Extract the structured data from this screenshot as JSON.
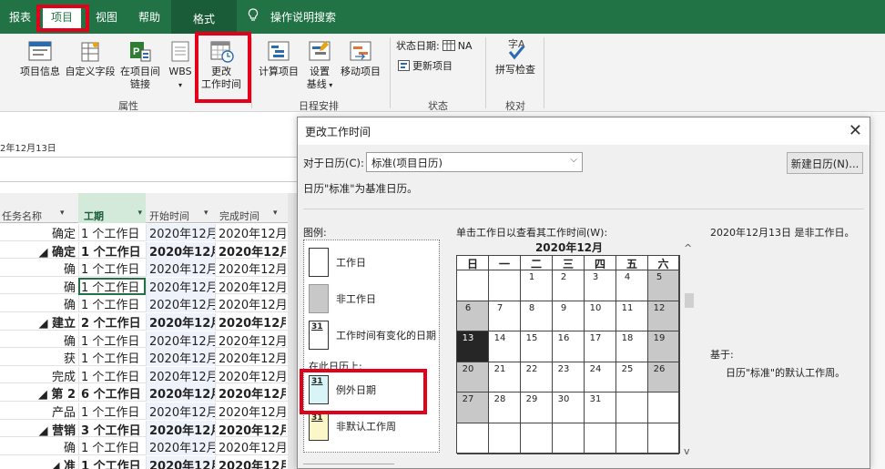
{
  "tabs": {
    "report": "报表",
    "project": "项目",
    "view": "视图",
    "help": "帮助",
    "format": "格式",
    "search": "操作说明搜索"
  },
  "ribbon": {
    "project_info": "项目信息",
    "custom_fields": "自定义字段",
    "links_line1": "在项目间",
    "links_line2": "链接",
    "wbs": "WBS",
    "change_time_line1": "更改",
    "change_time_line2": "工作时间",
    "calc_project": "计算项目",
    "set_baseline_line1": "设置",
    "set_baseline_line2": "基线",
    "move_project": "移动项目",
    "status_date_label": "状态日期:",
    "status_date_value": "NA",
    "update_project": "更新项目",
    "spell_check": "拼写检查",
    "groups": {
      "properties": "属性",
      "schedule": "日程安排",
      "status": "状态",
      "proofing": "校对"
    }
  },
  "timeline_date": "2年12月13日",
  "grid": {
    "headers": {
      "name": "任务名称",
      "duration": "工期",
      "start": "开始时间",
      "finish": "完成时间"
    },
    "rows": [
      {
        "name": "确定",
        "dur": "1 个工作日",
        "start": "2020年12月",
        "end": "2020年12月",
        "bold": false,
        "hl": false
      },
      {
        "name": "◢ 确定",
        "dur": "1 个工作日",
        "start": "2020年12月",
        "end": "2020年12月",
        "bold": true,
        "hl": false
      },
      {
        "name": "确",
        "dur": "1 个工作日",
        "start": "2020年12月",
        "end": "2020年12月",
        "bold": false,
        "hl": false
      },
      {
        "name": "确",
        "dur": "1 个工作日",
        "start": "2020年12月",
        "end": "2020年12月",
        "bold": false,
        "hl": true
      },
      {
        "name": "确",
        "dur": "1 个工作日",
        "start": "2020年12月",
        "end": "2020年12月",
        "bold": false,
        "hl": false
      },
      {
        "name": "◢ 建立",
        "dur": "2 个工作日",
        "start": "2020年12月",
        "end": "2020年12月",
        "bold": true,
        "hl": false
      },
      {
        "name": "确",
        "dur": "1 个工作日",
        "start": "2020年12月",
        "end": "2020年12月",
        "bold": false,
        "hl": false
      },
      {
        "name": "获",
        "dur": "1 个工作日",
        "start": "2020年12月",
        "end": "2020年12月",
        "bold": false,
        "hl": false
      },
      {
        "name": "完成",
        "dur": "1 个工作日",
        "start": "2020年12月",
        "end": "2020年12月",
        "bold": false,
        "hl": false
      },
      {
        "name": "◢ 第 2",
        "dur": "6 个工作日",
        "start": "2020年12月",
        "end": "2020年12月",
        "bold": true,
        "hl": false
      },
      {
        "name": "产品",
        "dur": "1 个工作日",
        "start": "2020年12月",
        "end": "2020年12月",
        "bold": false,
        "hl": false
      },
      {
        "name": "◢ 营销",
        "dur": "3 个工作日",
        "start": "2020年12月",
        "end": "2020年12月",
        "bold": true,
        "hl": false
      },
      {
        "name": "确",
        "dur": "1 个工作日",
        "start": "2020年12月",
        "end": "2020年12月",
        "bold": false,
        "hl": false
      },
      {
        "name": "◢ 准",
        "dur": "1 个工作日",
        "start": "2020年12月",
        "end": "2020年12月",
        "bold": true,
        "hl": false
      }
    ]
  },
  "dialog": {
    "title": "更改工作时间",
    "for_calendar_label": "对于日历(C):",
    "calendar_value": "标准(项目日历)",
    "new_calendar_button": "新建日历(N)...",
    "based_text": "日历\"标准\"为基准日历。",
    "legend_title": "图例:",
    "legend_working": "工作日",
    "legend_nonworking": "非工作日",
    "legend_changed": "工作时间有变化的日期",
    "legend_on_calendar": "在此日历上:",
    "legend_exception": "例外日期",
    "legend_nondefault": "非默认工作周",
    "legend_num": "31",
    "click_hint": "单击工作日以查看其工作时间(W):",
    "month_title": "2020年12月",
    "weekdays": [
      "日",
      "一",
      "二",
      "三",
      "四",
      "五",
      "六"
    ],
    "selected_info": "2020年12月13日 是非工作日。",
    "based_on_label": "基于:",
    "based_on_text": "日历\"标准\"的默认工作周。"
  },
  "calendar_days": [
    [
      "",
      "",
      "1",
      "2",
      "3",
      "4",
      "5"
    ],
    [
      "6",
      "7",
      "8",
      "9",
      "10",
      "11",
      "12"
    ],
    [
      "13",
      "14",
      "15",
      "16",
      "17",
      "18",
      "19"
    ],
    [
      "20",
      "21",
      "22",
      "23",
      "24",
      "25",
      "26"
    ],
    [
      "27",
      "28",
      "29",
      "30",
      "31",
      "",
      ""
    ],
    [
      "",
      "",
      "",
      "",
      "",
      "",
      ""
    ]
  ],
  "colors": {
    "ribbon_green": "#217346",
    "highlight_red": "#e3001b",
    "nonworking_gray": "#c8c8c8",
    "selected_day": "#262626"
  }
}
